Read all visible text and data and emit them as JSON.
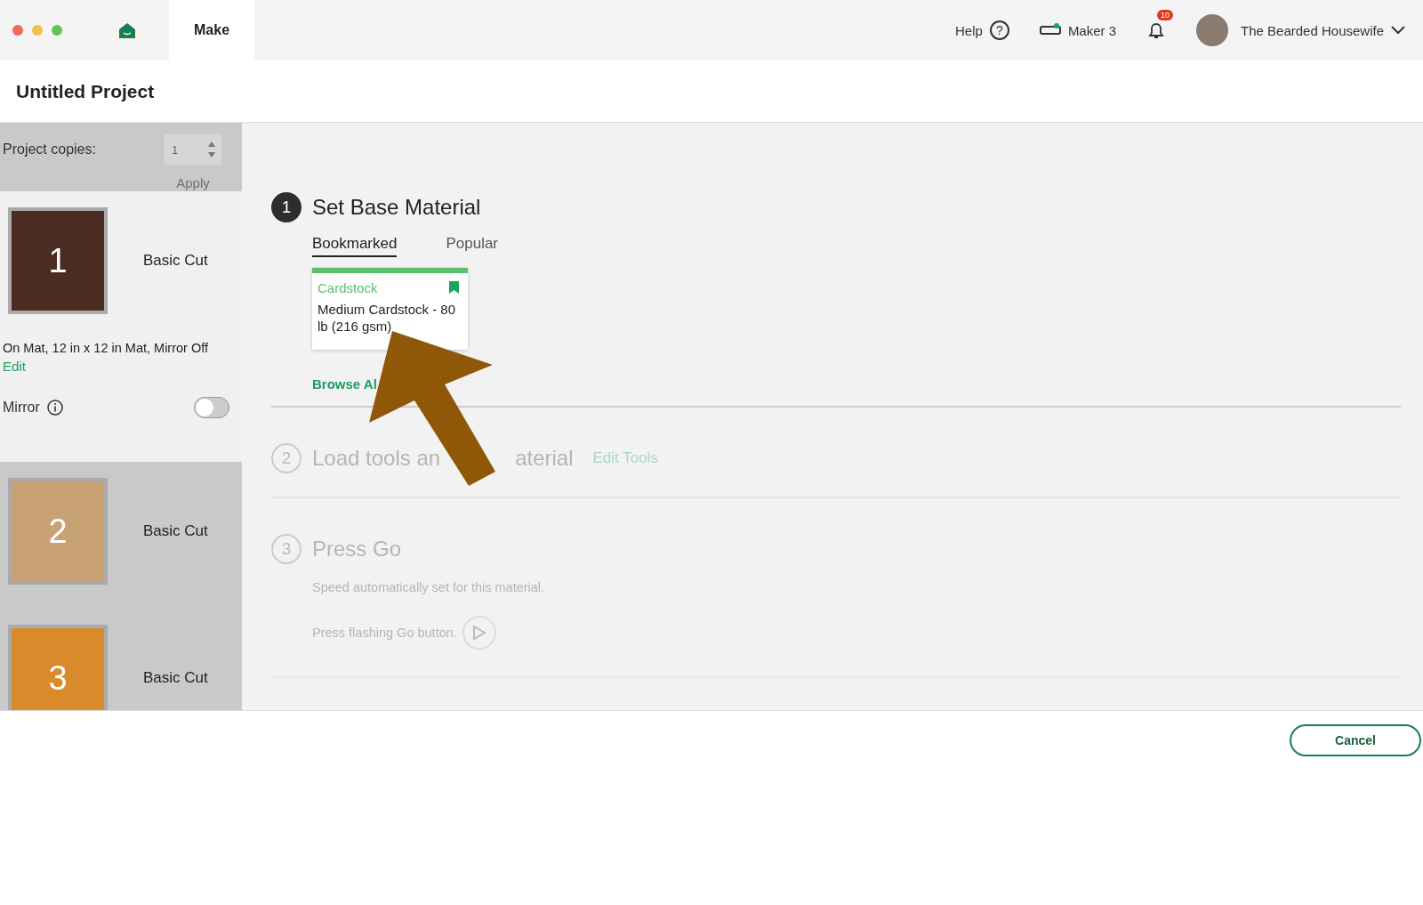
{
  "top_bar": {
    "tabs": [
      {
        "label": "Make",
        "selected": true
      }
    ],
    "help": "Help",
    "help_icon": "?",
    "machine": "Maker 3",
    "notifications": "10",
    "user": "The Bearded Housewife"
  },
  "project": {
    "title": "Untitled Project"
  },
  "sidebar": {
    "copies_label": "Project copies:",
    "copies_value": "1",
    "apply": "Apply",
    "apply_disabled": true,
    "mats": [
      {
        "number": "1",
        "label": "Basic Cut",
        "color": "#4a2c22",
        "selected": true,
        "details": "On Mat, 12 in x 12 in Mat, Mirror Off",
        "edit": "Edit",
        "mirror_label": "Mirror",
        "mirror_on": false
      },
      {
        "number": "2",
        "label": "Basic Cut",
        "color": "#c8a274",
        "selected": false
      },
      {
        "number": "3",
        "label": "Basic Cut",
        "color": "#d98b2b",
        "selected": false
      }
    ]
  },
  "steps": [
    {
      "number": "1",
      "active": true,
      "title": "Set Base Material",
      "tabs": [
        {
          "label": "Bookmarked",
          "selected": true
        },
        {
          "label": "Popular",
          "selected": false
        }
      ],
      "card": {
        "category": "Cardstock",
        "name": "Medium Cardstock - 80 lb (216 gsm)",
        "bookmarked": true
      },
      "link": "Browse Al"
    },
    {
      "number": "2",
      "active": false,
      "title": "Load tools an",
      "title_after": "aterial",
      "link": "Edit Tools"
    },
    {
      "number": "3",
      "active": false,
      "title": "Press Go",
      "note": "Speed automatically set for this material.",
      "go_text": "Press flashing Go button."
    }
  ],
  "footer": {
    "cancel": "Cancel"
  }
}
